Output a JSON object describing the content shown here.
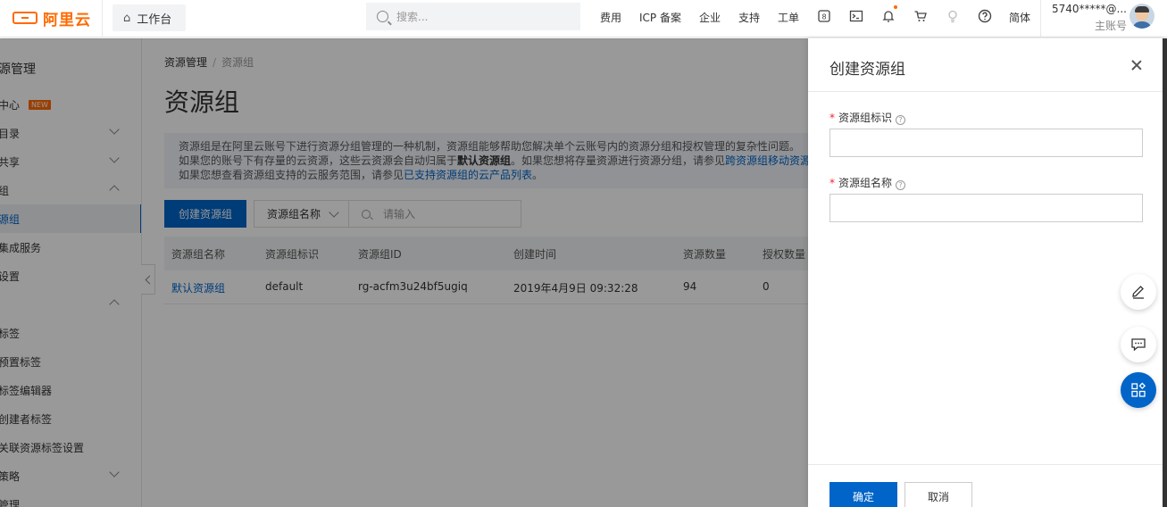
{
  "topbar": {
    "logo_text": "阿里云",
    "workbench_label": "工作台",
    "search_placeholder": "搜索...",
    "nav": [
      "费用",
      "ICP 备案",
      "企业",
      "支持",
      "工单"
    ],
    "icons": [
      "app-icon",
      "terminal-icon",
      "bell-icon",
      "cart-icon",
      "lightbulb-icon",
      "help-icon"
    ],
    "lang": "简体",
    "account_name": "5740*****@...",
    "account_role": "主账号"
  },
  "sidebar": {
    "title": "源管理",
    "items": [
      {
        "label": "中心",
        "badge": "NEW",
        "chevron": ""
      },
      {
        "label": "目录",
        "chevron": "down"
      },
      {
        "label": "共享",
        "chevron": "down"
      },
      {
        "label": "组",
        "chevron": "up"
      },
      {
        "label": "源组",
        "chevron": "",
        "active": true
      },
      {
        "label": "集成服务",
        "chevron": ""
      },
      {
        "label": "设置",
        "chevron": ""
      },
      {
        "label": "",
        "chevron": "up"
      },
      {
        "label": "标签",
        "chevron": ""
      },
      {
        "label": "预置标签",
        "chevron": ""
      },
      {
        "label": "标签编辑器",
        "chevron": ""
      },
      {
        "label": "创建者标签",
        "chevron": ""
      },
      {
        "label": "关联资源标签设置",
        "chevron": ""
      },
      {
        "label": "策略",
        "chevron": "down"
      },
      {
        "label": "管理",
        "chevron": ""
      }
    ]
  },
  "main": {
    "breadcrumb": [
      "资源管理",
      "资源组"
    ],
    "title": "资源组",
    "notice": {
      "line1": "资源组是在阿里云账号下进行资源分组管理的一种机制，资源组能够帮助您解决单个云账号内的资源分组和授权管理的复杂性问题。",
      "line2_pre": "如果您的账号下有存量的云资源，这些云资源会自动归属于",
      "line2_bold": "默认资源组",
      "line2_mid": "。如果您想将存量资源进行资源分组，请参见",
      "line2_link": "跨资源组移动资源",
      "line3_pre": "如果您想查看资源组支持的云服务范围，请参见",
      "line3_link": "已支持资源组的云产品列表",
      "line3_post": "。"
    },
    "create_button": "创建资源组",
    "filter_select": "资源组名称",
    "filter_placeholder": "请输入",
    "table": {
      "headers": [
        "资源组名称",
        "资源组标识",
        "资源组ID",
        "创建时间",
        "资源数量",
        "授权数量"
      ],
      "rows": [
        [
          "默认资源组",
          "default",
          "rg-acfm3u24bf5ugiq",
          "2019年4月9日 09:32:28",
          "94",
          "0"
        ]
      ]
    }
  },
  "drawer": {
    "title": "创建资源组",
    "field1_label": "资源组标识",
    "field1_value": "",
    "field2_label": "资源组名称",
    "field2_value": "",
    "required_mark": "*",
    "help_mark": "?",
    "ok_button": "确定",
    "cancel_button": "取消"
  },
  "colors": {
    "brand": "#ff6a00",
    "primary": "#0064c8",
    "required": "#f5222d"
  }
}
